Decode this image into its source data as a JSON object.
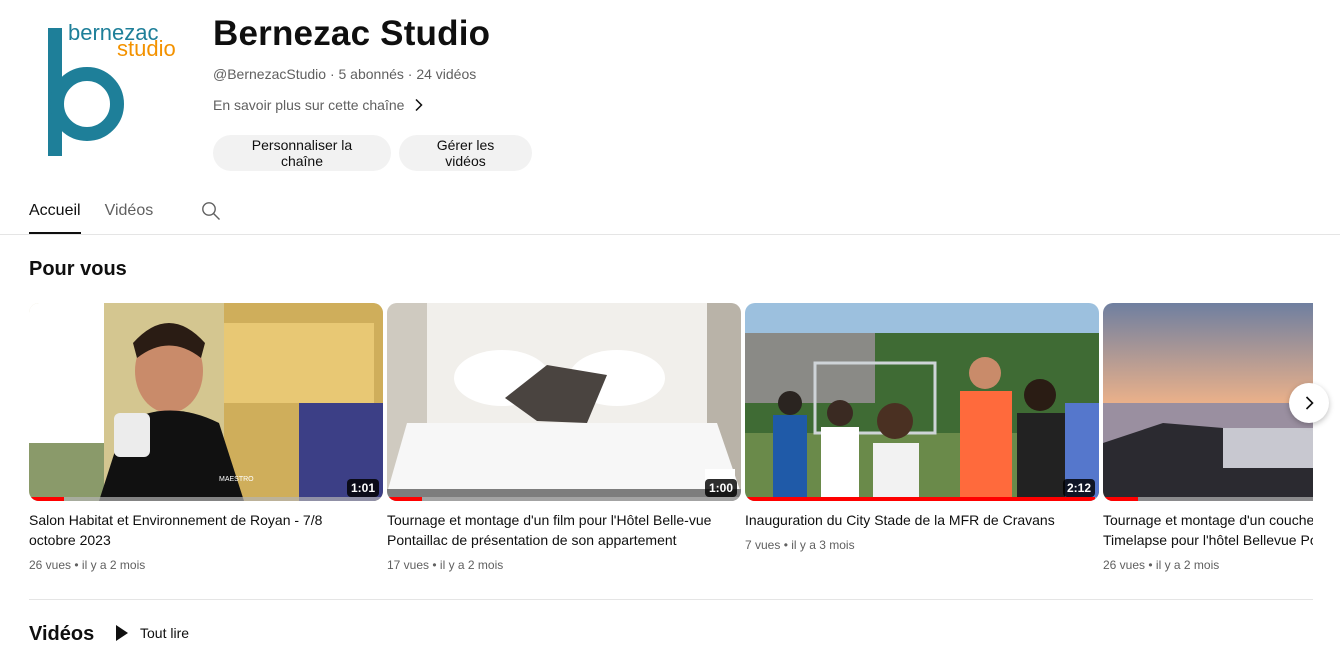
{
  "channel": {
    "logo_text_top": "bernezac",
    "logo_text_bottom": "studio",
    "name": "Bernezac Studio",
    "meta": "@BernezacStudio · 5 abonnés · 24 vidéos",
    "about_link": "En savoir plus sur cette chaîne",
    "brand_colors": {
      "teal": "#1e7f99",
      "orange": "#f39200"
    }
  },
  "actions": {
    "customize_label": "Personnaliser la chaîne",
    "manage_label": "Gérer les vidéos"
  },
  "tabs": [
    {
      "label": "Accueil",
      "active": true
    },
    {
      "label": "Vidéos",
      "active": false
    }
  ],
  "for_you": {
    "title": "Pour vous",
    "videos": [
      {
        "title": "Salon Habitat et Environnement de Royan - 7/8\noctobre 2023",
        "duration": "1:01",
        "meta": "26 vues • il y a 2 mois",
        "progress": 0.1
      },
      {
        "title": "Tournage et montage d'un film pour l'Hôtel Belle-vue\nPontaillac de présentation de son appartement",
        "duration": "1:00",
        "meta": "17 vues • il y a 2 mois",
        "progress": 0.1
      },
      {
        "title": "Inauguration du City Stade de la MFR de Cravans",
        "duration": "2:12",
        "meta": "7 vues • il y a 3 mois",
        "progress": 0.99
      },
      {
        "title": "Tournage et montage d'un coucher\nTimelapse pour l'hôtel Bellevue Po",
        "duration": "",
        "meta": "26 vues • il y a 2 mois",
        "progress": 0.1
      }
    ]
  },
  "videos_section": {
    "title": "Vidéos",
    "play_all_label": "Tout lire"
  },
  "icons": {
    "search": "search-icon",
    "chevron": "chevron-right-icon",
    "play": "play-icon"
  }
}
